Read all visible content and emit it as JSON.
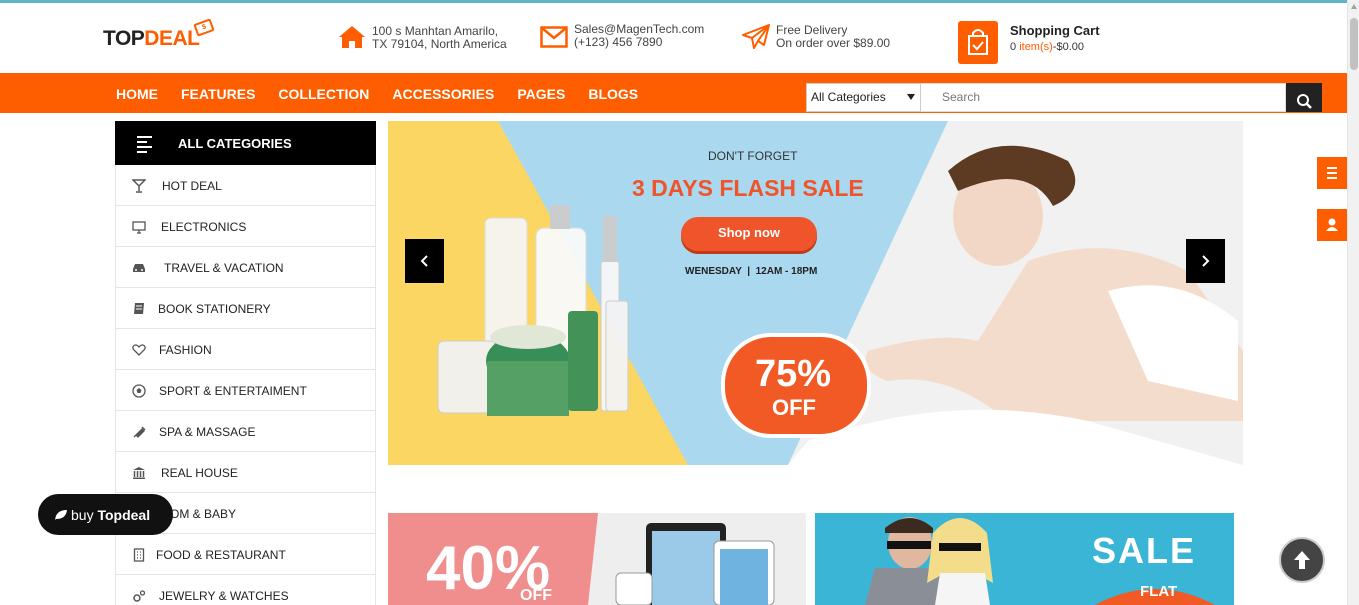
{
  "logo": {
    "part1": "TOP",
    "part2": "DEAL",
    "tag": "$"
  },
  "header": {
    "address": {
      "line1": "100 s Manhtan Amarilo,",
      "line2": "TX 79104, North America"
    },
    "contact": {
      "line1": "Sales@MagenTech.com",
      "line2": "(+123) 456 7890"
    },
    "delivery": {
      "line1": "Free Delivery",
      "line2": "On order over $89.00"
    },
    "cart": {
      "title": "Shopping Cart",
      "count": "0",
      "items_label": "item(s)",
      "total": "-$0.00"
    }
  },
  "nav": {
    "items": [
      "HOME",
      "FEATURES",
      "COLLECTION",
      "ACCESSORIES",
      "PAGES",
      "BLOGS"
    ],
    "category_select": "All Categories",
    "search_placeholder": "Search"
  },
  "categories": {
    "title": "ALL CATEGORIES",
    "items": [
      {
        "label": "HOT DEAL",
        "icon": "cocktail-icon"
      },
      {
        "label": "ELECTRONICS",
        "icon": "monitor-icon"
      },
      {
        "label": "TRAVEL & VACATION",
        "icon": "car-icon"
      },
      {
        "label": "BOOK STATIONERY",
        "icon": "book-icon"
      },
      {
        "label": "FASHION",
        "icon": "heart-icon"
      },
      {
        "label": "SPORT & ENTERTAIMENT",
        "icon": "soccer-ball-icon"
      },
      {
        "label": "SPA & MASSAGE",
        "icon": "syringe-icon"
      },
      {
        "label": "REAL HOUSE",
        "icon": "bank-icon"
      },
      {
        "label": "MOM & BABY",
        "icon": "baby-icon"
      },
      {
        "label": "FOOD & RESTAURANT",
        "icon": "building-icon"
      },
      {
        "label": "JEWELRY & WATCHES",
        "icon": "cog-icon"
      }
    ]
  },
  "banner": {
    "kicker": "DON'T FORGET",
    "headline": "3 DAYS FLASH SALE",
    "button": "Shop now",
    "schedule": "WENESDAY  |  12AM - 18PM",
    "discount": "75%",
    "discount_sub": "OFF"
  },
  "promo1": {
    "percent": "40%",
    "sub": "OFF"
  },
  "promo2": {
    "sale": "SALE",
    "flat": "FLAT"
  },
  "buy": {
    "prefix": "buy ",
    "brand": "Topdeal"
  },
  "colors": {
    "accent": "#ff5e00",
    "dark": "#000000"
  }
}
